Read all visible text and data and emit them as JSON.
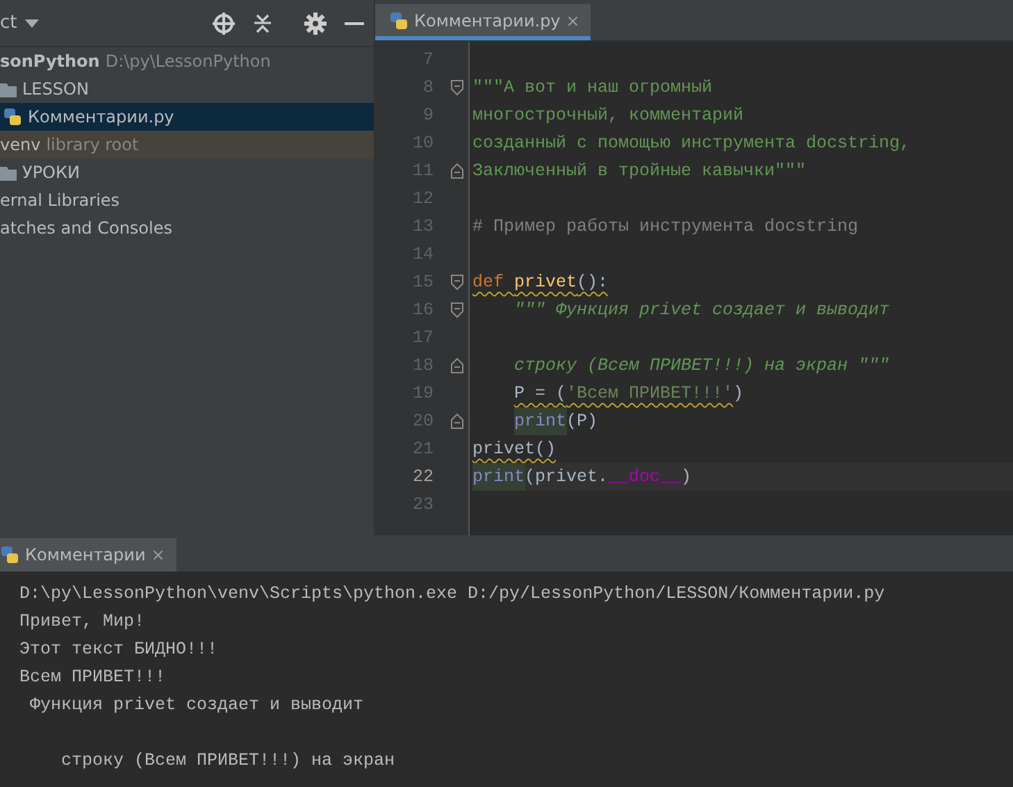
{
  "project_panel": {
    "title": "ct",
    "toolbar": [
      {
        "kind": "locate"
      },
      {
        "kind": "collapse"
      },
      {
        "kind": "settings"
      },
      {
        "kind": "hide"
      }
    ],
    "items": [
      {
        "kind": "project",
        "label": "sonPython",
        "hint": "D:\\py\\LessonPython",
        "selected": false
      },
      {
        "kind": "folder",
        "label": "LESSON",
        "selected": false
      },
      {
        "kind": "file",
        "label": "Комментарии.py",
        "selected": true
      },
      {
        "kind": "library",
        "label": "venv",
        "hint": "library root",
        "selected": false
      },
      {
        "kind": "folder",
        "label": "УРОКИ",
        "selected": false
      },
      {
        "kind": "plain",
        "label": "ernal Libraries",
        "selected": false
      },
      {
        "kind": "plain",
        "label": "atches and Consoles",
        "selected": false
      }
    ]
  },
  "editor": {
    "tabs": [
      {
        "label": "Комментарии.py",
        "close": "×",
        "selected": true
      }
    ],
    "lines": [
      {
        "number": "7"
      },
      {
        "number": "8",
        "fold_start": true,
        "tokens": [
          {
            "kind": "docstring",
            "text": "\"\"\"А вот и наш огромный"
          }
        ]
      },
      {
        "number": "9",
        "tokens": [
          {
            "kind": "docstring",
            "text": "многострочный, комментарий"
          }
        ]
      },
      {
        "number": "10",
        "tokens": [
          {
            "kind": "docstring",
            "text": "созданный с помощью инструмента docstring,"
          }
        ]
      },
      {
        "number": "11",
        "fold_end": true,
        "tokens": [
          {
            "kind": "docstring",
            "text": "Заключенный в тройные кавычки\"\"\""
          }
        ]
      },
      {
        "number": "12"
      },
      {
        "number": "13",
        "tokens": [
          {
            "kind": "comment",
            "text": "# Пример работы инструмента docstring"
          }
        ]
      },
      {
        "number": "14"
      },
      {
        "number": "15",
        "fold_start": true,
        "tokens": [
          {
            "kind": "keyword",
            "text": "def ",
            "warning": true
          },
          {
            "kind": "funcname",
            "text": "privet",
            "warning": true
          },
          {
            "kind": "plain",
            "text": "():",
            "warning": true
          }
        ]
      },
      {
        "number": "16",
        "fold_start": true,
        "indented": true,
        "tokens": [
          {
            "kind": "docitalic",
            "text": "\"\"\" Функция privet создает и выводит"
          }
        ]
      },
      {
        "number": "17"
      },
      {
        "number": "18",
        "fold_end": true,
        "indented": true,
        "tokens": [
          {
            "kind": "docitalic",
            "text": "строку (Всем ПРИВЕТ!!!) на экран \"\"\""
          }
        ]
      },
      {
        "number": "19",
        "indented": true,
        "tokens": [
          {
            "kind": "plain",
            "text": "P = (",
            "warning": true
          },
          {
            "kind": "string",
            "text": "'Всем ПРИВЕТ!!!'",
            "warning": true
          },
          {
            "kind": "plain",
            "text": ")"
          }
        ]
      },
      {
        "number": "20",
        "fold_end": true,
        "indented": true,
        "tokens": [
          {
            "kind": "builtin",
            "text": "print",
            "highlighted": true
          },
          {
            "kind": "plain",
            "text": "(P)"
          }
        ]
      },
      {
        "number": "21",
        "tokens": [
          {
            "kind": "plain",
            "text": "privet()",
            "warning": true
          }
        ]
      },
      {
        "number": "22",
        "current": true,
        "tokens": [
          {
            "kind": "builtin",
            "text": "print",
            "highlighted": true
          },
          {
            "kind": "plain",
            "text": "(privet."
          },
          {
            "kind": "magic",
            "text": "__doc__"
          },
          {
            "kind": "plain",
            "text": ")"
          }
        ]
      },
      {
        "number": "23"
      }
    ]
  },
  "run_panel": {
    "tabs": [
      {
        "label": "Комментарии",
        "close": "×",
        "selected": true
      }
    ],
    "output": [
      {
        "text": "D:\\py\\LessonPython\\venv\\Scripts\\python.exe D:/py/LessonPython/LESSON/Комментарии.py"
      },
      {
        "text": "Привет, Мир!"
      },
      {
        "text": "Этот текст БИДНО!!!"
      },
      {
        "text": "Всем ПРИВЕТ!!!"
      },
      {
        "text": " Функция privet создает и выводит"
      },
      {
        "text": "    строку (Всем ПРИВЕТ!!!) на экран",
        "blank_line_before": true
      }
    ]
  }
}
